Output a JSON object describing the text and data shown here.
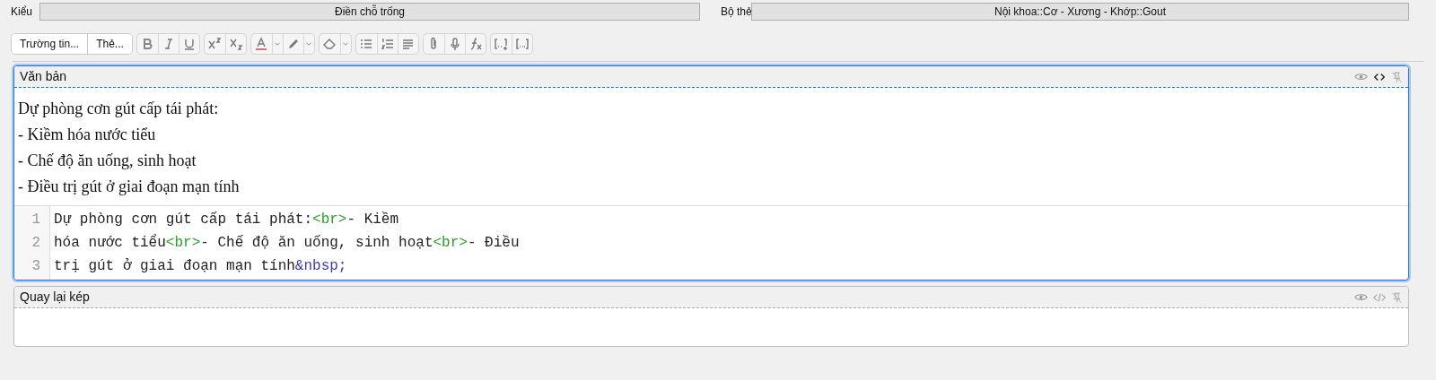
{
  "top_bar": [
    {
      "label": "Kiểu",
      "value": "Điền chỗ trống"
    },
    {
      "label": "Bộ thẻ",
      "value": "Nội khoa::Cơ - Xương - Khớp::Gout"
    }
  ],
  "toolbar": {
    "text_buttons": [
      "Trường tin...",
      "Thẻ..."
    ]
  },
  "fields": [
    {
      "name": "Văn bản",
      "focused": true,
      "html_editor_open": true,
      "content": [
        "Dự phòng cơn gút cấp tái phát:",
        "- Kiềm hóa nước tiểu",
        "- Chế độ ăn uống, sinh hoạt",
        "- Điều trị gút ở giai đoạn mạn tính"
      ],
      "code_lines": [
        {
          "number": "1",
          "tokens": [
            {
              "kind": "text",
              "text": "Dự phòng cơn gút cấp tái phát:"
            },
            {
              "kind": "tag",
              "text": "<br>"
            },
            {
              "kind": "text",
              "text": "- Kiềm"
            }
          ]
        },
        {
          "number": "2",
          "tokens": [
            {
              "kind": "text",
              "text": "hóa nước tiểu"
            },
            {
              "kind": "tag",
              "text": "<br>"
            },
            {
              "kind": "text",
              "text": "- Chế độ ăn uống, sinh hoạt"
            },
            {
              "kind": "tag",
              "text": "<br>"
            },
            {
              "kind": "text",
              "text": "- Điều"
            }
          ]
        },
        {
          "number": "3",
          "tokens": [
            {
              "kind": "text",
              "text": "trị gút ở giai đoạn mạn tính"
            },
            {
              "kind": "entity",
              "text": "&nbsp;"
            }
          ]
        }
      ]
    },
    {
      "name": "Quay lại kép",
      "focused": false,
      "html_editor_open": false
    }
  ]
}
